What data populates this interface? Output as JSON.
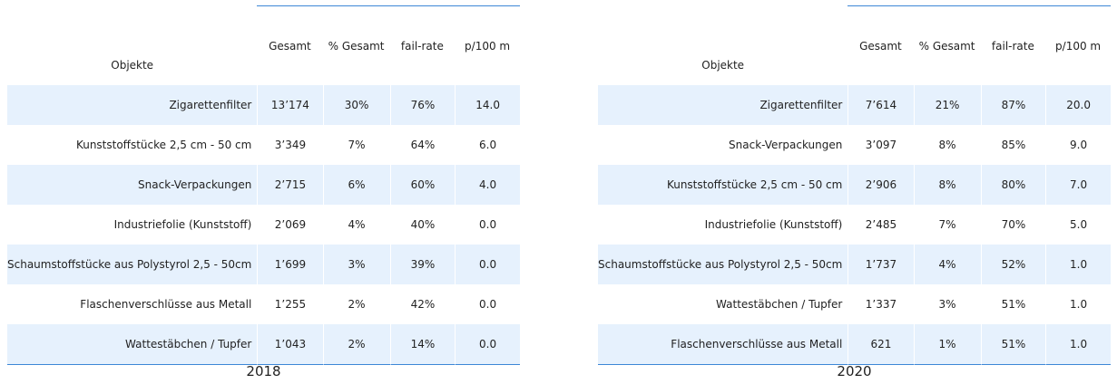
{
  "chart_data": [
    {
      "type": "table",
      "title": "2018",
      "columns": [
        "Objekte",
        "Gesamt",
        "% Gesamt",
        "fail-rate",
        "p/100 m"
      ],
      "rows": [
        [
          "Zigarettenfilter",
          "13’174",
          "30%",
          "76%",
          "14.0"
        ],
        [
          "Kunststoffstücke 2,5 cm - 50 cm",
          "3’349",
          "7%",
          "64%",
          "6.0"
        ],
        [
          "Snack-Verpackungen",
          "2’715",
          "6%",
          "60%",
          "4.0"
        ],
        [
          "Industriefolie (Kunststoff)",
          "2’069",
          "4%",
          "40%",
          "0.0"
        ],
        [
          "Schaumstoffstücke aus Polystyrol 2,5 - 50cm",
          "1’699",
          "3%",
          "39%",
          "0.0"
        ],
        [
          "Flaschenverschlüsse aus Metall",
          "1’255",
          "2%",
          "42%",
          "0.0"
        ],
        [
          "Wattestäbchen / Tupfer",
          "1’043",
          "2%",
          "14%",
          "0.0"
        ]
      ]
    },
    {
      "type": "table",
      "title": "2020",
      "columns": [
        "Objekte",
        "Gesamt",
        "% Gesamt",
        "fail-rate",
        "p/100 m"
      ],
      "rows": [
        [
          "Zigarettenfilter",
          "7’614",
          "21%",
          "87%",
          "20.0"
        ],
        [
          "Snack-Verpackungen",
          "3’097",
          "8%",
          "85%",
          "9.0"
        ],
        [
          "Kunststoffstücke 2,5 cm - 50 cm",
          "2’906",
          "8%",
          "80%",
          "7.0"
        ],
        [
          "Industriefolie (Kunststoff)",
          "2’485",
          "7%",
          "70%",
          "5.0"
        ],
        [
          "Schaumstoffstücke aus Polystyrol 2,5 - 50cm",
          "1’737",
          "4%",
          "52%",
          "1.0"
        ],
        [
          "Wattestäbchen / Tupfer",
          "1’337",
          "3%",
          "51%",
          "1.0"
        ],
        [
          "Flaschenverschlüsse aus Metall",
          "621",
          "1%",
          "51%",
          "1.0"
        ]
      ]
    }
  ],
  "colors": {
    "row_shade": "#e6f1fd",
    "rule": "#3d87d6"
  }
}
